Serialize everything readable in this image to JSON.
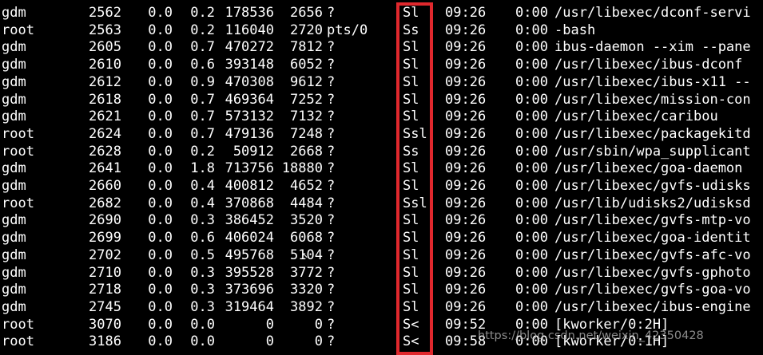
{
  "annotation": {
    "highlight_color": "#e0282d",
    "watermark": "https://blog.csdn.net/weixin_42350428"
  },
  "colors": {
    "background": "#000000",
    "foreground": "#ffffff"
  },
  "rows": [
    {
      "user": "gdm",
      "pid": "2562",
      "cpu": "0.0",
      "mem": "0.2",
      "vsz": "178536",
      "rss": "2656",
      "tty": "?",
      "stat": "Sl",
      "start": "09:26",
      "time": "0:00",
      "command": "/usr/libexec/dconf-servi"
    },
    {
      "user": "root",
      "pid": "2563",
      "cpu": "0.0",
      "mem": "0.2",
      "vsz": "116040",
      "rss": "2720",
      "tty": "pts/0",
      "stat": "Ss",
      "start": "09:26",
      "time": "0:00",
      "command": "-bash"
    },
    {
      "user": "gdm",
      "pid": "2605",
      "cpu": "0.0",
      "mem": "0.7",
      "vsz": "470272",
      "rss": "7812",
      "tty": "?",
      "stat": "Sl",
      "start": "09:26",
      "time": "0:00",
      "command": "ibus-daemon --xim --pane"
    },
    {
      "user": "gdm",
      "pid": "2610",
      "cpu": "0.0",
      "mem": "0.6",
      "vsz": "393148",
      "rss": "6052",
      "tty": "?",
      "stat": "Sl",
      "start": "09:26",
      "time": "0:00",
      "command": "/usr/libexec/ibus-dconf"
    },
    {
      "user": "gdm",
      "pid": "2612",
      "cpu": "0.0",
      "mem": "0.9",
      "vsz": "470308",
      "rss": "9612",
      "tty": "?",
      "stat": "Sl",
      "start": "09:26",
      "time": "0:00",
      "command": "/usr/libexec/ibus-x11 --"
    },
    {
      "user": "gdm",
      "pid": "2618",
      "cpu": "0.0",
      "mem": "0.7",
      "vsz": "469364",
      "rss": "7252",
      "tty": "?",
      "stat": "Sl",
      "start": "09:26",
      "time": "0:00",
      "command": "/usr/libexec/mission-con"
    },
    {
      "user": "gdm",
      "pid": "2621",
      "cpu": "0.0",
      "mem": "0.7",
      "vsz": "573132",
      "rss": "7132",
      "tty": "?",
      "stat": "Sl",
      "start": "09:26",
      "time": "0:00",
      "command": "/usr/libexec/caribou"
    },
    {
      "user": "root",
      "pid": "2624",
      "cpu": "0.0",
      "mem": "0.7",
      "vsz": "479136",
      "rss": "7248",
      "tty": "?",
      "stat": "Ssl",
      "start": "09:26",
      "time": "0:00",
      "command": "/usr/libexec/packagekitd"
    },
    {
      "user": "root",
      "pid": "2628",
      "cpu": "0.0",
      "mem": "0.2",
      "vsz": "50912",
      "rss": "2668",
      "tty": "?",
      "stat": "Ss",
      "start": "09:26",
      "time": "0:00",
      "command": "/usr/sbin/wpa_supplicant"
    },
    {
      "user": "gdm",
      "pid": "2641",
      "cpu": "0.0",
      "mem": "1.8",
      "vsz": "713756",
      "rss": "18880",
      "tty": "?",
      "stat": "Sl",
      "start": "09:26",
      "time": "0:00",
      "command": "/usr/libexec/goa-daemon"
    },
    {
      "user": "gdm",
      "pid": "2660",
      "cpu": "0.0",
      "mem": "0.4",
      "vsz": "400812",
      "rss": "4652",
      "tty": "?",
      "stat": "Sl",
      "start": "09:26",
      "time": "0:00",
      "command": "/usr/libexec/gvfs-udisks"
    },
    {
      "user": "root",
      "pid": "2682",
      "cpu": "0.0",
      "mem": "0.4",
      "vsz": "370868",
      "rss": "4484",
      "tty": "?",
      "stat": "Ssl",
      "start": "09:26",
      "time": "0:00",
      "command": "/usr/lib/udisks2/udisksd"
    },
    {
      "user": "gdm",
      "pid": "2690",
      "cpu": "0.0",
      "mem": "0.3",
      "vsz": "386452",
      "rss": "3520",
      "tty": "?",
      "stat": "Sl",
      "start": "09:26",
      "time": "0:00",
      "command": "/usr/libexec/gvfs-mtp-vo"
    },
    {
      "user": "gdm",
      "pid": "2699",
      "cpu": "0.0",
      "mem": "0.6",
      "vsz": "406024",
      "rss": "6068",
      "tty": "?",
      "stat": "Sl",
      "start": "09:26",
      "time": "0:00",
      "command": "/usr/libexec/goa-identit"
    },
    {
      "user": "gdm",
      "pid": "2702",
      "cpu": "0.0",
      "mem": "0.5",
      "vsz": "495768",
      "rss": "5104",
      "tty": "?",
      "stat": "Sl",
      "start": "09:26",
      "time": "0:00",
      "command": "/usr/libexec/gvfs-afc-vo"
    },
    {
      "user": "gdm",
      "pid": "2710",
      "cpu": "0.0",
      "mem": "0.3",
      "vsz": "395528",
      "rss": "3772",
      "tty": "?",
      "stat": "Sl",
      "start": "09:26",
      "time": "0:00",
      "command": "/usr/libexec/gvfs-gphoto"
    },
    {
      "user": "gdm",
      "pid": "2718",
      "cpu": "0.0",
      "mem": "0.3",
      "vsz": "373696",
      "rss": "3320",
      "tty": "?",
      "stat": "Sl",
      "start": "09:26",
      "time": "0:00",
      "command": "/usr/libexec/gvfs-goa-vo"
    },
    {
      "user": "gdm",
      "pid": "2745",
      "cpu": "0.0",
      "mem": "0.3",
      "vsz": "319464",
      "rss": "3892",
      "tty": "?",
      "stat": "Sl",
      "start": "09:26",
      "time": "0:00",
      "command": "/usr/libexec/ibus-engine"
    },
    {
      "user": "root",
      "pid": "3070",
      "cpu": "0.0",
      "mem": "0.0",
      "vsz": "0",
      "rss": "0",
      "tty": "?",
      "stat": "S<",
      "start": "09:52",
      "time": "0:00",
      "command": "[kworker/0:2H]"
    },
    {
      "user": "root",
      "pid": "3186",
      "cpu": "0.0",
      "mem": "0.0",
      "vsz": "0",
      "rss": "0",
      "tty": "?",
      "stat": "S<",
      "start": "09:58",
      "time": "0:00",
      "command": "[kworker/0:1H]"
    }
  ]
}
